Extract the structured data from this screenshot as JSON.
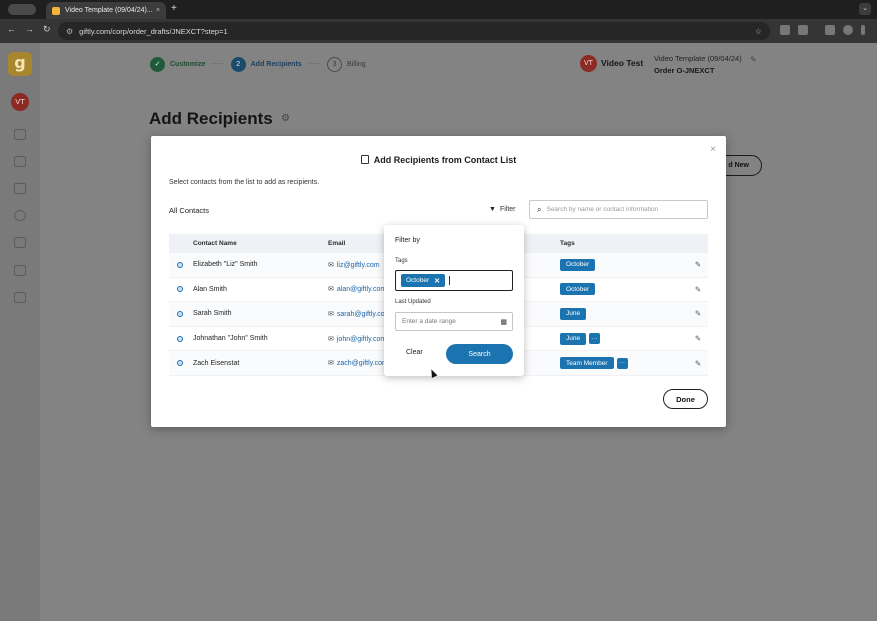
{
  "browser": {
    "tab_title": "Video Template (09/04/24)...",
    "tab_close": "×",
    "new_tab": "+",
    "url": "giftly.com/corp/order_drafts/JNEXCT?step=1",
    "nav_back": "←",
    "nav_forward": "→",
    "nav_reload": "↻",
    "star": "☆"
  },
  "sidebar": {
    "logo": "g",
    "avatar": "VT"
  },
  "steps": [
    {
      "label": "Customize",
      "state": "done",
      "marker": "✓"
    },
    {
      "label": "Add Recipients",
      "state": "current",
      "marker": "2"
    },
    {
      "label": "Billing",
      "state": "next",
      "marker": "3"
    }
  ],
  "step_separator": "----",
  "header": {
    "user_avatar": "VT",
    "user_name": "Video Test",
    "order_title": "Video Template (09/04/24)",
    "order_number": "Order O-JNEXCT"
  },
  "page": {
    "title": "Add Recipients",
    "add_new_label": "d New"
  },
  "modal": {
    "title": "Add Recipients from Contact List",
    "subtitle": "Select contacts from the list to add as recipients.",
    "all_contacts": "All Contacts",
    "filter_label": "Filter",
    "search_placeholder": "Search by name or contact information",
    "close": "×",
    "done_label": "Done",
    "columns": {
      "name": "Contact Name",
      "email": "Email",
      "tags": "Tags"
    },
    "rows": [
      {
        "name": "Elizabeth \"Liz\" Smith",
        "email": "liz@giftly.com",
        "tag": "October",
        "more": ""
      },
      {
        "name": "Alan Smith",
        "email": "alan@giftly.com",
        "tag": "October",
        "more": ""
      },
      {
        "name": "Sarah Smith",
        "email": "sarah@giftly.com",
        "tag": "June",
        "more": ""
      },
      {
        "name": "Johnathan \"John\" Smith",
        "email": "john@giftly.com",
        "tag": "June",
        "more": "···"
      },
      {
        "name": "Zach Eisenstat",
        "email": "zach@giftly.com",
        "tag": "Team Member",
        "more": "···"
      }
    ]
  },
  "filter": {
    "title": "Filter by",
    "tags_label": "Tags",
    "selected_tag": "October",
    "chip_remove": "✕",
    "last_updated_label": "Last Updated",
    "date_placeholder": "Enter a date range",
    "clear_label": "Clear",
    "search_label": "Search"
  },
  "colors": {
    "accent": "#1b74b0",
    "brand": "#a8862e",
    "avatar": "#8c2a24"
  }
}
